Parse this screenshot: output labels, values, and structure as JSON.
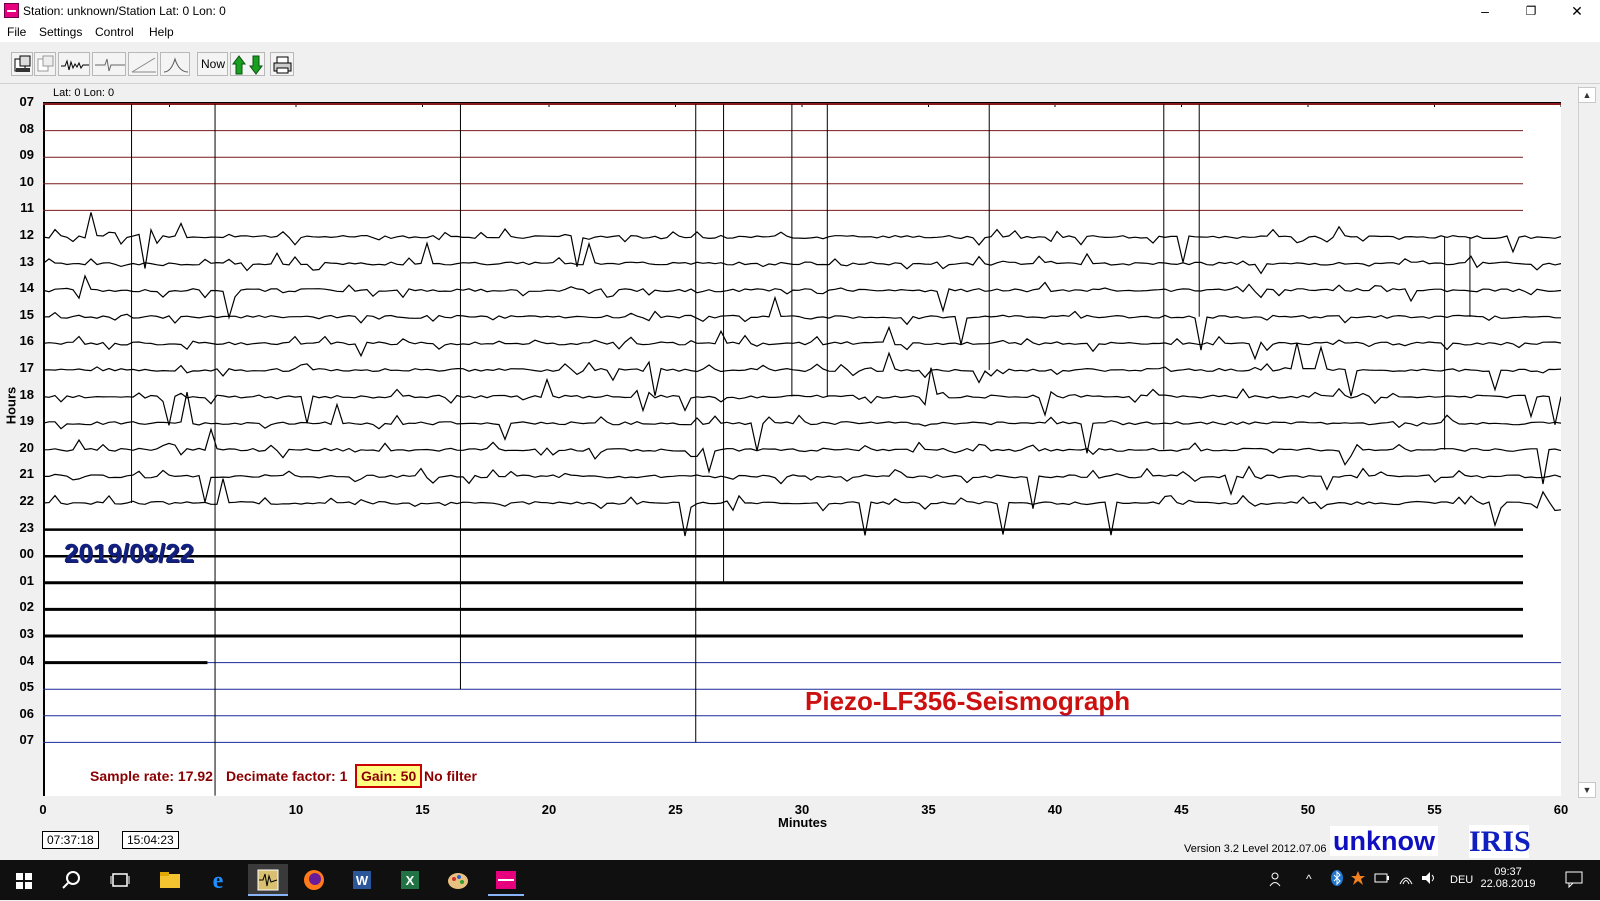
{
  "window": {
    "title": "Station: unknown/Station Lat: 0 Lon: 0",
    "minimize": "–",
    "maximize": "❐",
    "close": "✕"
  },
  "menu": [
    "File",
    "Settings",
    "Control",
    "Help"
  ],
  "toolbar": {
    "buttons": [
      "open-icon",
      "save-icon",
      "wave-icon",
      "trace-icon",
      "ramp-icon",
      "filter-curve-icon",
      "now-button",
      "gain-arrows-icon",
      "print-icon"
    ],
    "now_label": "Now"
  },
  "plot": {
    "latlon": "Lat: 0 Lon: 0",
    "y_axis_label": "Hours",
    "x_axis_label": "Minutes",
    "hour_labels": [
      "07",
      "08",
      "09",
      "10",
      "11",
      "12",
      "13",
      "14",
      "15",
      "16",
      "17",
      "18",
      "19",
      "20",
      "21",
      "22",
      "23",
      "00",
      "01",
      "02",
      "03",
      "04",
      "05",
      "06",
      "07"
    ],
    "minute_ticks": [
      "0",
      "5",
      "10",
      "15",
      "20",
      "25",
      "30",
      "35",
      "40",
      "45",
      "50",
      "55",
      "60"
    ],
    "date": "2019/08/22",
    "instrument": "Piezo-LF356-Seismograph",
    "recorded_lines": 21,
    "active_line_minutes": 6.5,
    "colors": {
      "recorded_trace": "#000000",
      "pending_line": "#1a2a9a",
      "top_line": "#8b1a1a"
    }
  },
  "status": {
    "sample_rate": "Sample rate: 17.92",
    "decimate": "Decimate factor: 1",
    "gain": "Gain: 50",
    "filter": "No filter"
  },
  "times": {
    "start": "07:37:18",
    "current": "15:04:23"
  },
  "version": "Version 3.2 Level 2012.07.06",
  "station_badge": "unknow",
  "logo": "IRIS",
  "taskbar": {
    "apps": [
      "windows-start-icon",
      "search-icon",
      "task-view-icon",
      "file-explorer-icon",
      "internet-explorer-icon",
      "winquake-icon",
      "firefox-icon",
      "word-icon",
      "excel-icon",
      "paint-icon",
      "seismograph-app-icon"
    ],
    "lang": "DEU",
    "time": "09:37",
    "date": "22.08.2019"
  }
}
